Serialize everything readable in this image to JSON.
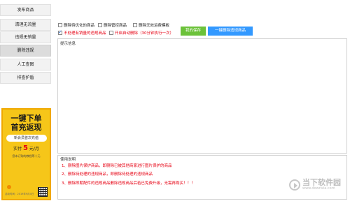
{
  "sidebar": {
    "items": [
      {
        "label": "发布商品"
      },
      {
        "label": "清理无流量"
      },
      {
        "label": "违规无销量"
      },
      {
        "label": "删除违规"
      },
      {
        "label": "人工查图"
      },
      {
        "label": "排查护盾"
      }
    ]
  },
  "ad": {
    "line1": "一键下单",
    "line2": "首充返现",
    "pill": "新会员首次充值",
    "promo_prefix": "实付",
    "promo_amount": "5",
    "promo_suffix": "元/月",
    "sub": "您本订购的教程等十元",
    "footer": "活动时间：2019年9月4日"
  },
  "options": {
    "opt1": "删除待优化的商品",
    "opt2": "删除管控商品",
    "opt3": "删除无效运费模板",
    "opt4": "不处理有销量的违规商品",
    "opt5": "开启自动删除（30分钟执行一次）"
  },
  "buttons": {
    "save": "我的保存",
    "delete_all": "一键删除违规商品"
  },
  "panels": {
    "tips_title": "提示信息",
    "usage_title": "使用说明"
  },
  "usage": {
    "line1": "1、删除图片保护商品，即删除已被其他商家进行图片保护的商品",
    "line2": "2、删除待处理的违规商品，即删除待处理的违规商品",
    "line3": "3、删除即期配件的违规商品删除违规商品后若已免费升级，无需再购买！！！"
  },
  "watermark": {
    "name": "当下软件园",
    "url": "www.downxia.com"
  },
  "colors": {
    "accent_green": "#6cc23a",
    "accent_blue": "#3399ff",
    "warning_red": "#e60012",
    "ad_yellow": "#f6c619"
  }
}
